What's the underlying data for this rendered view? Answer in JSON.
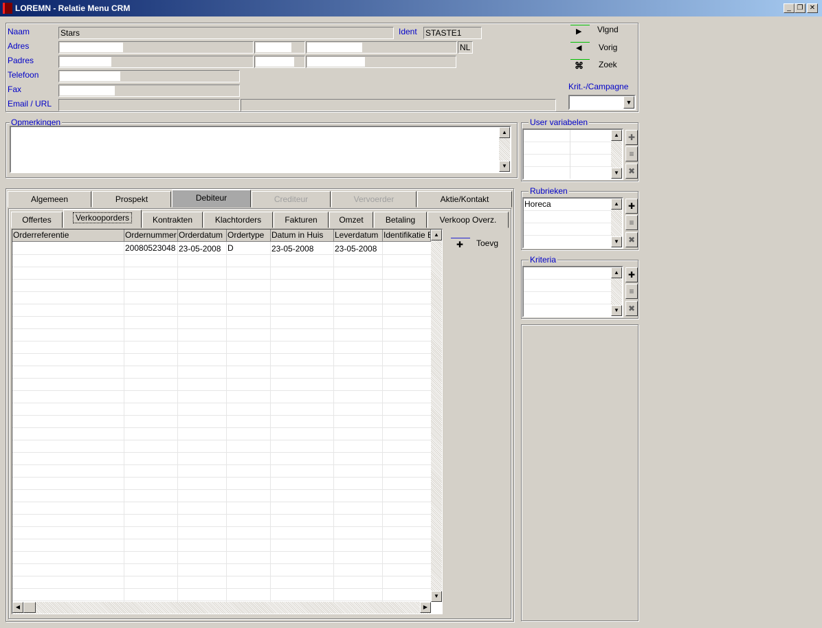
{
  "window": {
    "title": "LOREMN - Relatie Menu CRM",
    "min": "_",
    "restore": "❐",
    "close": "✕"
  },
  "header": {
    "naam_label": "Naam",
    "naam_value": "Stars",
    "ident_label": "Ident",
    "ident_value": "STASTE1",
    "adres_label": "Adres",
    "country_value": "NL",
    "padres_label": "Padres",
    "telefoon_label": "Telefoon",
    "fax_label": "Fax",
    "email_label": "Email / URL"
  },
  "nav": {
    "next_label": "Vlgnd",
    "prev_label": "Vorig",
    "search_label": "Zoek",
    "campaign_label": "Krit.-/Campagne"
  },
  "remarks": {
    "title": "Opmerkingen"
  },
  "user_vars": {
    "title": "User variabelen"
  },
  "rubrieken": {
    "title": "Rubrieken",
    "items": [
      "Horeca"
    ]
  },
  "kriteria": {
    "title": "Kriteria"
  },
  "main_tabs": [
    "Algemeen",
    "Prospekt",
    "Debiteur",
    "Crediteur",
    "Vervoerder",
    "Aktie/Kontakt"
  ],
  "sub_tabs": [
    "Offertes",
    "Verkooporders",
    "Kontrakten",
    "Klachtorders",
    "Fakturen",
    "Omzet",
    "Betaling",
    "Verkoop Overz."
  ],
  "orders": {
    "columns": [
      "Orderreferentie",
      "Ordernummer",
      "Orderdatum",
      "Ordertype",
      "Datum in Huis",
      "Leverdatum",
      "Identifikatie E"
    ],
    "rows": [
      [
        "",
        "20080523048",
        "23-05-2008",
        "D",
        "23-05-2008",
        "23-05-2008",
        ""
      ]
    ],
    "add_label": "Toevg"
  }
}
